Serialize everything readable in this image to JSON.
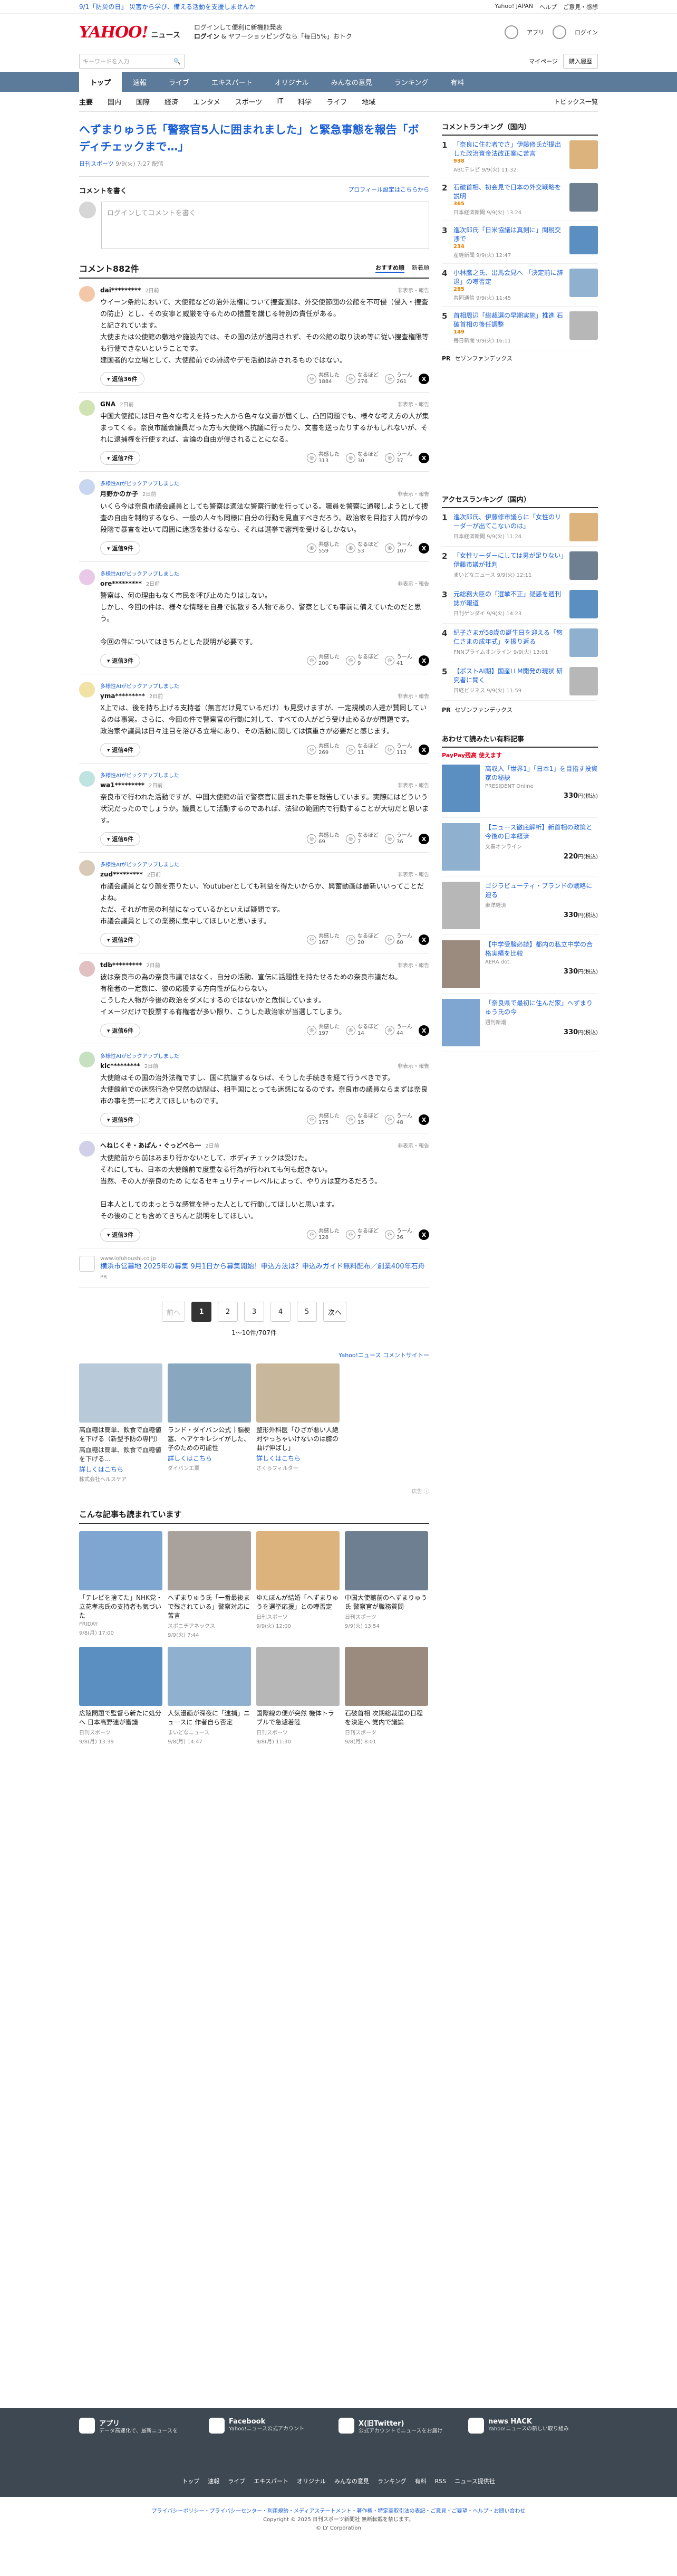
{
  "top": {
    "notice": "9/1「防災の日」 災害から学び、備える活動を支援しませんか",
    "links": [
      "Yahoo! JAPAN",
      "ヘルプ",
      "ご意見・感想"
    ]
  },
  "header": {
    "logo": "YAHOO!",
    "logo_sub": "ニュース",
    "promo1": "ログインして便利に新機能発表",
    "promo2": "ログイン",
    "promo3": "& ヤフーショッピングなら「毎日5%」おトク",
    "right": [
      "アプリ",
      "ログイン"
    ]
  },
  "search": {
    "placeholder": "キーワードを入力",
    "links": [
      "マイページ",
      "購入履歴"
    ]
  },
  "nav": [
    "トップ",
    "速報",
    "ライブ",
    "エキスパート",
    "オリジナル",
    "みんなの意見",
    "ランキング",
    "有料"
  ],
  "subnav": [
    "主要",
    "国内",
    "国際",
    "経済",
    "エンタメ",
    "スポーツ",
    "IT",
    "科学",
    "ライフ",
    "地域"
  ],
  "subnav_right": "トピックス一覧",
  "article": {
    "title": "へずまりゅう氏「警察官5人に囲まれました」と緊急事態を報告「ボディチェックまで…」",
    "source": "日刊スポーツ",
    "date": "9/9(火) 7:27 配信"
  },
  "comment_form": {
    "heading": "コメントを書く",
    "policy": "プロフィール設定はこちらから",
    "placeholder": "ログインしてコメントを書く"
  },
  "comment_list": {
    "count": "コメント882件",
    "sort": [
      "おすすめ順",
      "新着順"
    ]
  },
  "comments": [
    {
      "name": "dai*********",
      "time": "2日前",
      "expert": "",
      "text": "ウイーン条約において、大使館などの治外法権について捜査国は、外交使節団の公館を不可侵（侵入・捜査の防止）とし、その安寧と威厳を守るための措置を講じる特別の責任がある。\nと記されています。\n大使または公使館の敷地や施設内では、その国の法が適用されず、その公館の取り決め等に従い捜査権限等も行使できないということです。\n建国者的な立場として、大使館前での誹謗やデモ活動は許されるものではない。\n",
      "replies": "返信36件",
      "v1": "共感した",
      "n1": "1884",
      "v2": "なるほど",
      "n2": "276",
      "v3": "うーん",
      "n3": "261"
    },
    {
      "name": "GNA",
      "time": "2日前",
      "expert": "",
      "text": "中国大使館には日々色々な考えを持った人から色々な文書が届くし、凸凹問題でも、様々な考え方の人が集まってくる。奈良市議会議員だった方も大使館へ抗議に行ったり、文書を送ったりするかもしれないが、それに逮捕権を行使すれば、言論の自由が侵されることになる。",
      "replies": "返信7件",
      "v1": "共感した",
      "n1": "313",
      "v2": "なるほど",
      "n2": "30",
      "v3": "うーん",
      "n3": "37"
    },
    {
      "name": "月野かのか子",
      "time": "2日前",
      "expert": "多様性AIがピックアップしました",
      "text": "いくら今は奈良市議会議員としても警察は適法な警察行動を行っている。職員を警察に通報しようとして捜査の自由を制約するなら、一般の人々も同様に自分の行動を見直すべきだろう。政治家を目指す人間が今の段階で暴言を吐いて周囲に迷惑を掛けるなら、それは選挙で審判を受けるしかない。",
      "replies": "返信9件",
      "v1": "共感した",
      "n1": "559",
      "v2": "なるほど",
      "n2": "53",
      "v3": "うーん",
      "n3": "107"
    },
    {
      "name": "ore*********",
      "time": "2日前",
      "expert": "多様性AIがピックアップしました",
      "text": "警察は、何の理由もなく市民を呼び止めたりはしない。\nしかし、今回の件は、様々な情報を自身で拡散する人物であり、警察としても事前に備えていたのだと思う。\n\n今回の件についてはきちんとした説明が必要です。",
      "replies": "返信3件",
      "v1": "共感した",
      "n1": "200",
      "v2": "なるほど",
      "n2": "9",
      "v3": "うーん",
      "n3": "41"
    },
    {
      "name": "yma*********",
      "time": "2日前",
      "expert": "多様性AIがピックアップしました",
      "text": "X上では、後を持ち上げる支持者（無言だけ見ているだけ）も見受けますが、一定規模の人達が賛同しているのは事実。さらに、今回の件で警察官の行動に対して、すべての人がどう受け止めるかが問題です。\n政治家や議員は日々注目を浴びる立場にあり、その活動に関しては慎重さが必要だと感じます。",
      "replies": "返信4件",
      "v1": "共感した",
      "n1": "269",
      "v2": "なるほど",
      "n2": "11",
      "v3": "うーん",
      "n3": "112"
    },
    {
      "name": "wa1*********",
      "time": "2日前",
      "expert": "多様性AIがピックアップしました",
      "text": "奈良市で行われた活動ですが、中国大使館の前で警察官に囲まれた事を報告しています。実際にはどういう状況だったのでしょうか。議員として活動するのであれば、法律の範囲内で行動することが大切だと思います。\n",
      "replies": "返信6件",
      "v1": "共感した",
      "n1": "69",
      "v2": "なるほど",
      "n2": "7",
      "v3": "うーん",
      "n3": "36"
    },
    {
      "name": "zud*********",
      "time": "2日前",
      "expert": "多様性AIがピックアップしました",
      "text": "市議会議員となり顔を売りたい、Youtuberとしても利益を得たいからか、興奮動画は最新いいってことだよね。\nただ、それが市民の利益になっているかといえば疑問です。\n市議会議員としての業務に集中してほしいと思います。",
      "replies": "返信2件",
      "v1": "共感した",
      "n1": "167",
      "v2": "なるほど",
      "n2": "20",
      "v3": "うーん",
      "n3": "60"
    },
    {
      "name": "tdb*********",
      "time": "2日前",
      "expert": "",
      "text": "彼は奈良市の為の奈良市議ではなく、自分の活動、宣伝に話題性を持たせるための奈良市議だね。\n有権者の一定数に、彼の応援する方向性が伝わらない。\nこうした人物が今後の政治をダメにするのではないかと危惧しています。\nイメージだけで投票する有権者が多い限り、こうした政治家が当選してしまう。",
      "replies": "返信6件",
      "v1": "共感した",
      "n1": "197",
      "v2": "なるほど",
      "n2": "14",
      "v3": "うーん",
      "n3": "44"
    },
    {
      "name": "kic*********",
      "time": "2日前",
      "expert": "多様性AIがピックアップしました",
      "text": "大使館はその国の治外法権ですし、国に抗議するならば、そうした手続きを経て行うべきです。\n大使館前での迷惑行為や突然の訪問は、相手国にとっても迷惑になるのです。奈良市の議員ならまずは奈良市の事を第一に考えてほしいものです。",
      "replies": "返信5件",
      "v1": "共感した",
      "n1": "175",
      "v2": "なるほど",
      "n2": "15",
      "v3": "うーん",
      "n3": "48"
    },
    {
      "name": "へねじくそ・あぱん・ぐっどべら一",
      "time": "2日前",
      "expert": "",
      "text": "大使館前から前はあまり行かないとして、ボディチェックは受けた。\nそれにしても、日本の大使館前で度重なる行為が行われても何も起きない。\n当然、その人が奈良のため になるセキュリティーレベルによって、やり方は変わるだろう。\n\n日本人としてのまっとうな感覚を持った人として行動してほしいと思います。\nその後のことも含めてきちんと説明をしてほしい。",
      "replies": "返信3件",
      "v1": "共感した",
      "n1": "128",
      "v2": "なるほど",
      "n2": "7",
      "v3": "うーん",
      "n3": "36"
    }
  ],
  "ad": {
    "src": "www.lofuhoushi.co.jp",
    "title": "横浜市営墓地 2025年の募集 9月1日から募集開始！申込方法は？申込みガイド無料配布／創業400年石舟",
    "pr": "PR"
  },
  "pager": {
    "prev": "前へ",
    "pages": [
      "1",
      "2",
      "3",
      "4",
      "5"
    ],
    "next": "次へ",
    "info": "1〜10件/707件"
  },
  "promo_cards": {
    "head": "Yahoo!ニュース コメントサイトー",
    "items": [
      {
        "title": "高血糖は簡単、飲食で血糖値を下げる（新型予防の専門）",
        "desc": "高血糖は簡単、飲食で血糖値を下げる…",
        "more": "詳しくはこちら",
        "src": "株式会社ヘルスケア"
      },
      {
        "title": "ランド・ダイバン公式｜脳梗塞、ヘアケキレシイがした、子のための可能性",
        "desc": "",
        "more": "詳しくはこちら",
        "src": "ダイバン工業"
      },
      {
        "title": "整形外科医「ひざが悪い人絶対やっちゃいけないのは膝の曲げ伸ばし」",
        "desc": "",
        "more": "詳しくはこちら",
        "src": "さくらフィルター"
      }
    ],
    "caption": "広告 ⓘ"
  },
  "read_also": {
    "title": "こんな記事も読まれています",
    "items": [
      {
        "title": "「テレビを捨てた」NHK党・立花孝志氏の支持者も気づいた",
        "src": "FRIDAY",
        "date": "9/8(月) 17:00"
      },
      {
        "title": "へずまりゅう氏「一番最後まで残されている」警察対応に苦言",
        "src": "スポニチアネックス",
        "date": "9/9(火) 7:44"
      },
      {
        "title": "ゆたぼんが結婚「へずまりゅうを選挙応援」との噂否定",
        "src": "日刊スポーツ",
        "date": "9/9(火) 12:00"
      },
      {
        "title": "中国大使館前のへずまりゅう氏 警察官が職務質問",
        "src": "日刊スポーツ",
        "date": "9/9(火) 13:54"
      },
      {
        "title": "広陵問題で監督ら新たに処分へ 日本高野連が審議",
        "src": "日刊スポーツ",
        "date": "9/8(月) 13:39"
      },
      {
        "title": "人気漫画が深夜に「逮捕」ニュースに 作者自ら否定",
        "src": "まいどなニュース",
        "date": "9/8(月) 14:47"
      },
      {
        "title": "国際線の便が突然 機体トラブルで急遽着陸",
        "src": "日刊スポーツ",
        "date": "9/8(月) 11:30"
      },
      {
        "title": "石破首相 次期総裁選の日程を決定へ 党内で議論",
        "src": "日刊スポーツ",
        "date": "9/8(月) 8:01"
      }
    ]
  },
  "ranking_domestic": {
    "title": "コメントランキング（国内）",
    "items": [
      {
        "title": "「奈良に住む者でさ」伊藤修氏が提出した政治資金法改正案に苦言",
        "count": "938",
        "src": "ABCテレビ 9/9(火) 11:32"
      },
      {
        "title": "石破首相、初会見で日本の外交戦略を説明",
        "count": "365",
        "src": "日本経済新聞 9/9(火) 13:24"
      },
      {
        "title": "進次郎氏「日米協議は真剣に」関税交渉で",
        "count": "234",
        "src": "産経新聞 9/9(火) 12:47"
      },
      {
        "title": "小林鷹之氏、出馬会見へ 「決定前に辞退」の噂否定",
        "count": "285",
        "src": "共同通信 9/9(火) 11:45"
      },
      {
        "title": "首相周辺「総裁選の早期実施」推進 石破首相の後任調整",
        "count": "149",
        "src": "毎日新聞 9/9(火) 16:11"
      }
    ],
    "pr": "セゾンファンデックス"
  },
  "ranking_access": {
    "title": "アクセスランキング（国内）",
    "items": [
      {
        "title": "進次郎氏、伊藤修市議らに「女性のリーダーが出てこないのは」",
        "src": "日本経済新聞 9/9(火) 11:24"
      },
      {
        "title": "「女性リーダーにしては男が足りない」伊藤市議が批判",
        "src": "まいどなニュース 9/9(火) 12:11"
      },
      {
        "title": "元総務大臣の「選挙不正」疑惑を週刊誌が報道",
        "src": "日刊ゲンダイ 9/9(火) 14:23"
      },
      {
        "title": "紀子さまが58歳の誕生日を迎える「悠仁さまの成年式」を振り返る",
        "src": "FNNプライムオンライン 9/9(火) 13:01"
      },
      {
        "title": "【ポストAI期】国産LLM開発の現状 研究者に聞く",
        "src": "日経ビジネス 9/9(火) 11:59"
      }
    ],
    "pr": "セゾンファンデックス"
  },
  "books": {
    "title": "あわせて読みたい有料記事",
    "pr": "PayPay残高 使えます",
    "items": [
      {
        "title": "高収入「世界1」「日本1」を目指す投資家の秘訣",
        "src": "PRESIDENT Online",
        "price": "330",
        "unit": "円(税込)"
      },
      {
        "title": "【ニュース徹底解析】新首相の政策と今後の日本経済",
        "src": "文春オンライン",
        "price": "220",
        "unit": "円(税込)"
      },
      {
        "title": "ゴジラビューティ・ブランドの戦略に迫る",
        "src": "東洋経済",
        "price": "330",
        "unit": "円(税込)"
      },
      {
        "title": "【中学受験必読】都内の私立中学の合格実績を比較",
        "src": "AERA dot.",
        "price": "330",
        "unit": "円(税込)"
      },
      {
        "title": "「奈良県で最初に住んだ家」へずまりゅう氏の今",
        "src": "週刊新潮",
        "price": "330",
        "unit": "円(税込)"
      }
    ]
  },
  "footer": {
    "items": [
      {
        "title": "アプリ",
        "desc": "データ高速化で、最新ニュースを"
      },
      {
        "title": "Facebook",
        "desc": "Yahoo!ニュース公式アカウント"
      },
      {
        "title": "X(旧Twitter)",
        "desc": "公式アカウントでニュースをお届け"
      },
      {
        "title": "news HACK",
        "desc": "Yahoo!ニュースの新しい取り組み"
      }
    ],
    "links": [
      "トップ",
      "速報",
      "ライブ",
      "エキスパート",
      "オリジナル",
      "みんなの意見",
      "ランキング",
      "有料",
      "RSS",
      "ニュース提供社"
    ],
    "legal": "プライバシーポリシー・プライバシーセンター・利用規約・メディアステートメント・著作権・特定商取引法の表記・ご意見・ご要望・ヘルプ・お問い合わせ",
    "copy": "Copyright © 2025 日刊スポーツ新聞社 無断転載を禁じます。",
    "copy2": "© LY Corporation"
  },
  "colors": {
    "accent": "#1a5ed5",
    "nav": "#5c7a99",
    "brand": "#e3001c"
  }
}
